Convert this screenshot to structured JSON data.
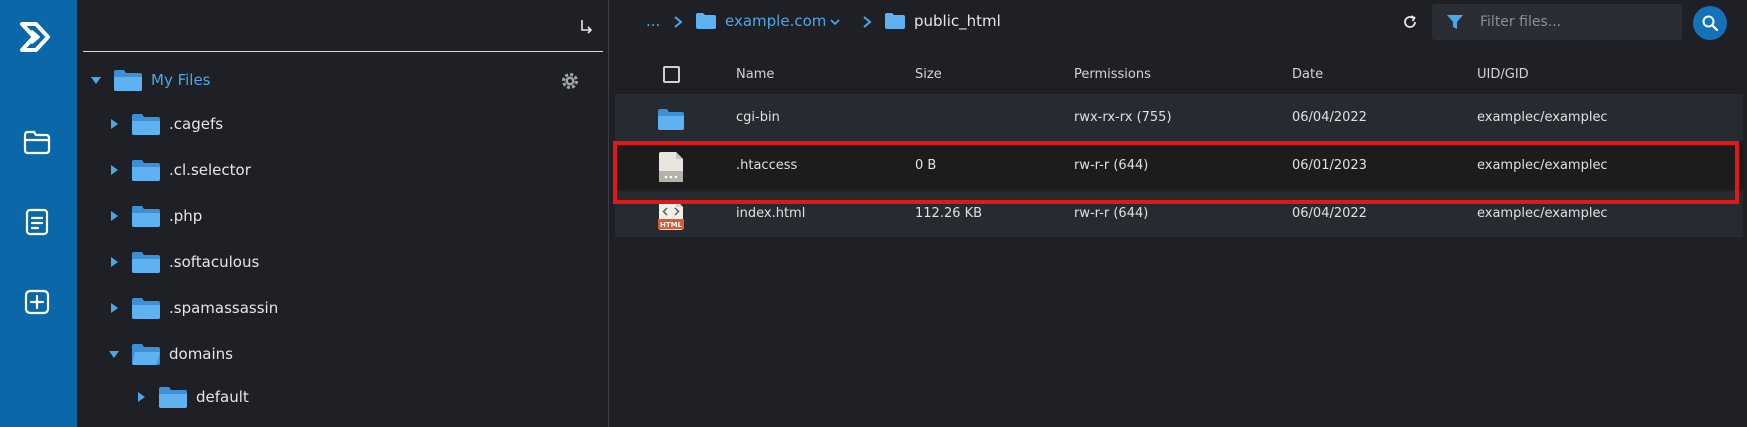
{
  "tree": {
    "root": {
      "label": "My Files"
    },
    "items": [
      {
        "label": ".cagefs"
      },
      {
        "label": ".cl.selector"
      },
      {
        "label": ".php"
      },
      {
        "label": ".softaculous"
      },
      {
        "label": ".spamassassin"
      },
      {
        "label": "domains"
      },
      {
        "label": "default"
      }
    ]
  },
  "breadcrumb": {
    "ellipsis": "...",
    "domain": "example.com",
    "current": "public_html"
  },
  "filter": {
    "placeholder": "Filter files..."
  },
  "table": {
    "columns": [
      "Name",
      "Size",
      "Permissions",
      "Date",
      "UID/GID"
    ],
    "rows": [
      {
        "icon": "folder-icon",
        "name": "cgi-bin",
        "size": "",
        "permissions": "rwx-rx-rx (755)",
        "date": "06/04/2022",
        "uidgid": "examplec/examplec"
      },
      {
        "icon": "file-icon",
        "name": ".htaccess",
        "size": "0 B",
        "permissions": "rw-r-r (644)",
        "date": "06/01/2023",
        "uidgid": "examplec/examplec"
      },
      {
        "icon": "html-file-icon",
        "name": "index.html",
        "size": "112.26 KB",
        "permissions": "rw-r-r (644)",
        "date": "06/04/2022",
        "uidgid": "examplec/examplec"
      }
    ]
  },
  "html_badge": "HTML",
  "colors": {
    "rail": "#0b68a8",
    "accent": "#4aa8e8",
    "highlight": "#e01818"
  }
}
